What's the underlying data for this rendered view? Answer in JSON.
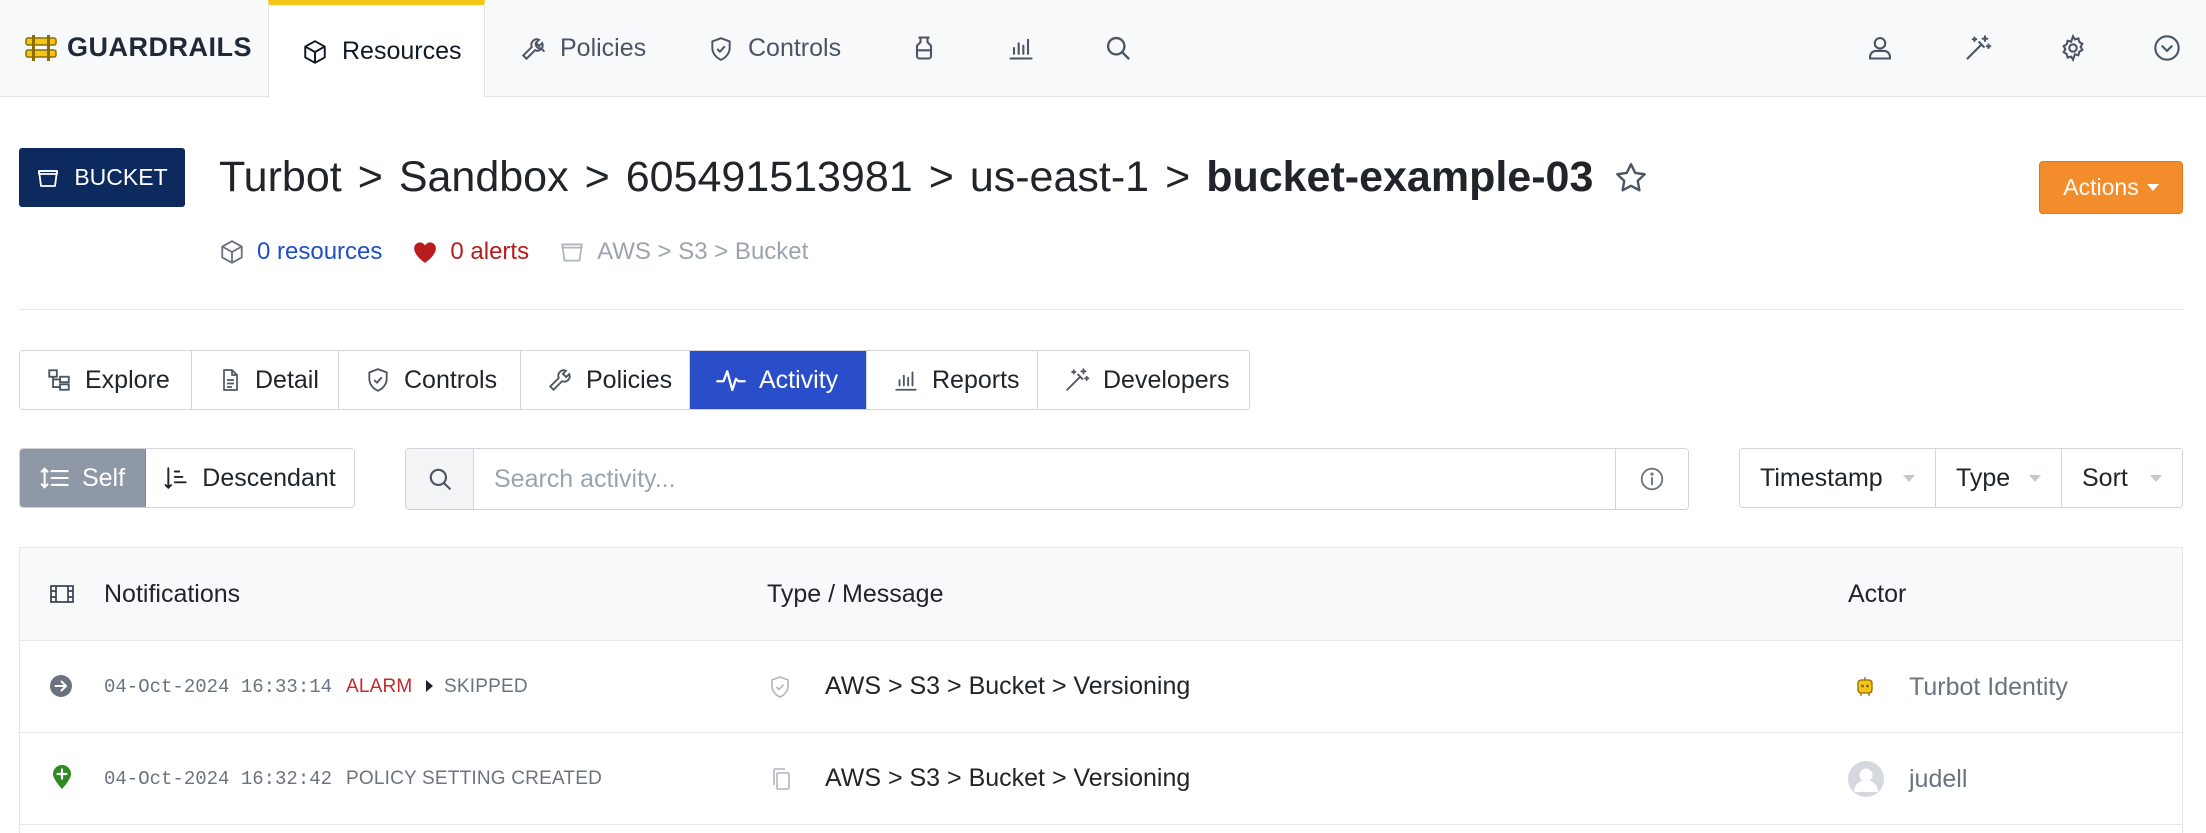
{
  "app": {
    "brand": "GUARDRAILS"
  },
  "topnav": {
    "tabs": [
      {
        "label": "Resources",
        "icon": "cube-icon",
        "active": true
      },
      {
        "label": "Policies",
        "icon": "wrench-icon"
      },
      {
        "label": "Controls",
        "icon": "shield-check-icon"
      }
    ],
    "icon_buttons": [
      "flask-icon",
      "bar-chart-icon",
      "search-icon"
    ],
    "right_icons": [
      "user-icon",
      "magic-wand-icon",
      "gear-icon",
      "chevron-down-circle-icon"
    ]
  },
  "header": {
    "type_badge": "BUCKET",
    "breadcrumb": [
      "Turbot",
      "Sandbox",
      "605491513981",
      "us-east-1"
    ],
    "separator": ">",
    "current": "bucket-example-03",
    "actions_label": "Actions",
    "resources": "0 resources",
    "alerts": "0 alerts",
    "type_path": "AWS > S3 > Bucket"
  },
  "tabs": [
    {
      "label": "Explore",
      "icon": "hierarchy-icon"
    },
    {
      "label": "Detail",
      "icon": "document-icon"
    },
    {
      "label": "Controls",
      "icon": "shield-check-icon"
    },
    {
      "label": "Policies",
      "icon": "wrench-icon"
    },
    {
      "label": "Activity",
      "icon": "activity-icon",
      "active": true
    },
    {
      "label": "Reports",
      "icon": "bar-chart-icon"
    },
    {
      "label": "Developers",
      "icon": "magic-wand-icon"
    }
  ],
  "filters": {
    "scope_self": "Self",
    "scope_descendant": "Descendant",
    "search_placeholder": "Search activity...",
    "timestamp": "Timestamp",
    "type": "Type",
    "sort": "Sort"
  },
  "table": {
    "headers": {
      "notifications": "Notifications",
      "type_message": "Type / Message",
      "actor": "Actor"
    },
    "rows": [
      {
        "event_icon": "arrow-right-circle-icon",
        "timestamp": "04-Oct-2024 16:33:14",
        "status": "ALARM",
        "status_next": "SKIPPED",
        "type_icon": "shield-icon",
        "message": "AWS > S3 > Bucket > Versioning",
        "actor_icon": "turbot-identity-icon",
        "actor": "Turbot Identity"
      },
      {
        "event_icon": "plus-marker-icon",
        "timestamp": "04-Oct-2024 16:32:42",
        "status": "POLICY SETTING CREATED",
        "type_icon": "copy-icon",
        "message": "AWS > S3 > Bucket > Versioning",
        "actor_icon": "user-avatar-icon",
        "actor": "judell"
      }
    ]
  },
  "colors": {
    "accent_yellow": "#f5c518",
    "badge_navy": "#0d2a5e",
    "actions_orange": "#f38c2b",
    "tab_active_blue": "#2a4ec9",
    "alarm_red": "#c62828",
    "link_blue": "#1f4fc4"
  }
}
